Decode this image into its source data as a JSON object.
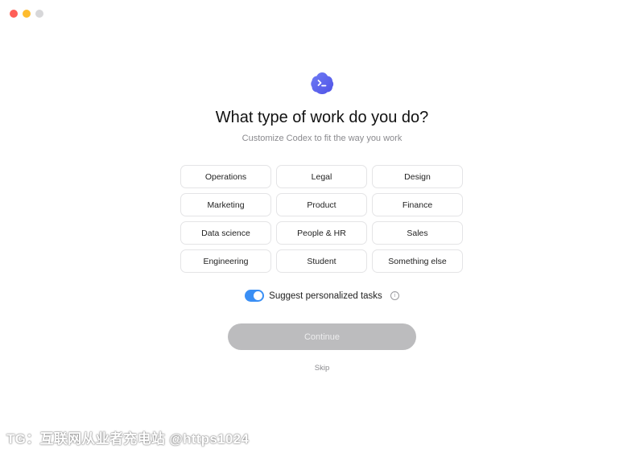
{
  "window": {
    "controls": [
      "close",
      "minimize",
      "zoom"
    ]
  },
  "logo": {
    "icon": "codex-terminal-cloud-icon",
    "colors": {
      "primary": "#5b6cf0",
      "secondary": "#8b5cf6"
    }
  },
  "header": {
    "title": "What type of work do you do?",
    "subtitle": "Customize Codex to fit the way you work"
  },
  "work_types": [
    {
      "label": "Operations"
    },
    {
      "label": "Legal"
    },
    {
      "label": "Design"
    },
    {
      "label": "Marketing"
    },
    {
      "label": "Product"
    },
    {
      "label": "Finance"
    },
    {
      "label": "Data science"
    },
    {
      "label": "People & HR"
    },
    {
      "label": "Sales"
    },
    {
      "label": "Engineering"
    },
    {
      "label": "Student"
    },
    {
      "label": "Something else"
    }
  ],
  "suggest_toggle": {
    "label": "Suggest personalized tasks",
    "checked": true,
    "info_icon": "info-icon",
    "accent": "#3a8ff5"
  },
  "actions": {
    "continue_label": "Continue",
    "skip_label": "Skip"
  },
  "watermark": {
    "text": "TG：互联网从业者充电站 @https1024"
  }
}
